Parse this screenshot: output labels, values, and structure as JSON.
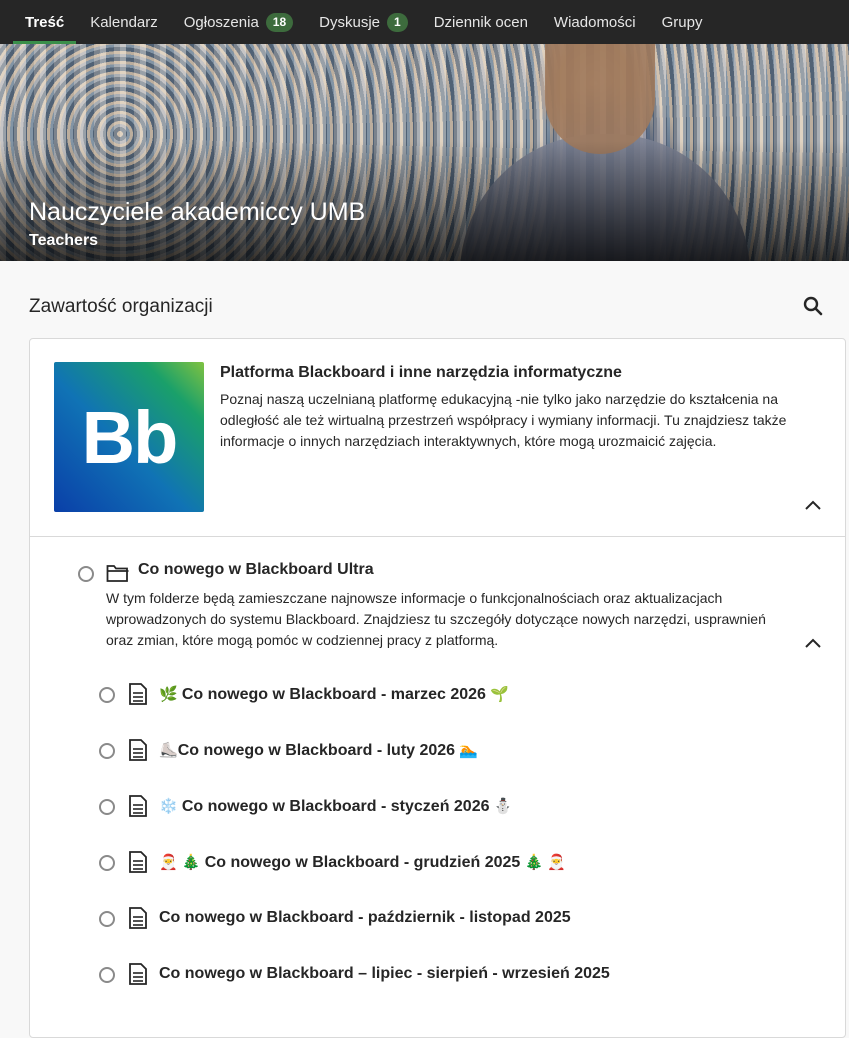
{
  "nav": {
    "tabs": [
      {
        "label": "Treść",
        "active": true
      },
      {
        "label": "Kalendarz"
      },
      {
        "label": "Ogłoszenia",
        "badge": "18"
      },
      {
        "label": "Dyskusje",
        "badge": "1"
      },
      {
        "label": "Dziennik ocen"
      },
      {
        "label": "Wiadomości"
      },
      {
        "label": "Grupy"
      }
    ]
  },
  "banner": {
    "title": "Nauczyciele akademiccy UMB",
    "subtitle": "Teachers"
  },
  "content": {
    "title": "Zawartość organizacji",
    "search_icon": "search-icon"
  },
  "card": {
    "logo_text": "Bb",
    "title": "Platforma Blackboard i inne narzędzia informatyczne",
    "description": "Poznaj naszą uczelnianą platformę edukacyjną -nie tylko jako narzędzie do kształcenia na odległość ale też wirtualną przestrzeń współpracy i wymiany informacji. Tu znajdziesz także informacje o innych narzędziach interaktywnych, które mogą urozmaicić zajęcia."
  },
  "folder": {
    "title": "Co nowego w Blackboard Ultra",
    "description": "W tym folderze będą zamieszczane najnowsze informacje o funkcjonalnościach oraz aktualizacjach wprowadzonych do systemu Blackboard. Znajdziesz tu szczegóły dotyczące nowych narzędzi, usprawnień oraz zmian, które mogą pomóc w codziennej pracy z platformą.",
    "items": [
      {
        "prefix": "🌿 ",
        "label": "Co nowego w Blackboard - marzec 2026",
        "suffix": " 🌱"
      },
      {
        "prefix": "⛸️",
        "label": "Co nowego w Blackboard - luty 2026",
        "suffix": " 🏊"
      },
      {
        "prefix": "❄️ ",
        "label": "Co nowego w Blackboard - styczeń 2026",
        "suffix": " ⛄"
      },
      {
        "prefix": "🎅 🎄 ",
        "label": "Co nowego w Blackboard - grudzień 2025",
        "suffix": " 🎄 🎅"
      },
      {
        "prefix": "",
        "label": "Co nowego w Blackboard - październik - listopad 2025",
        "suffix": ""
      },
      {
        "prefix": "",
        "label": "Co nowego w Blackboard – lipiec - sierpień - wrzesień 2025",
        "suffix": ""
      }
    ]
  },
  "colors": {
    "nav_bg": "#262626",
    "active_underline": "#3a8f4a",
    "badge_bg": "#3d6b3d"
  }
}
